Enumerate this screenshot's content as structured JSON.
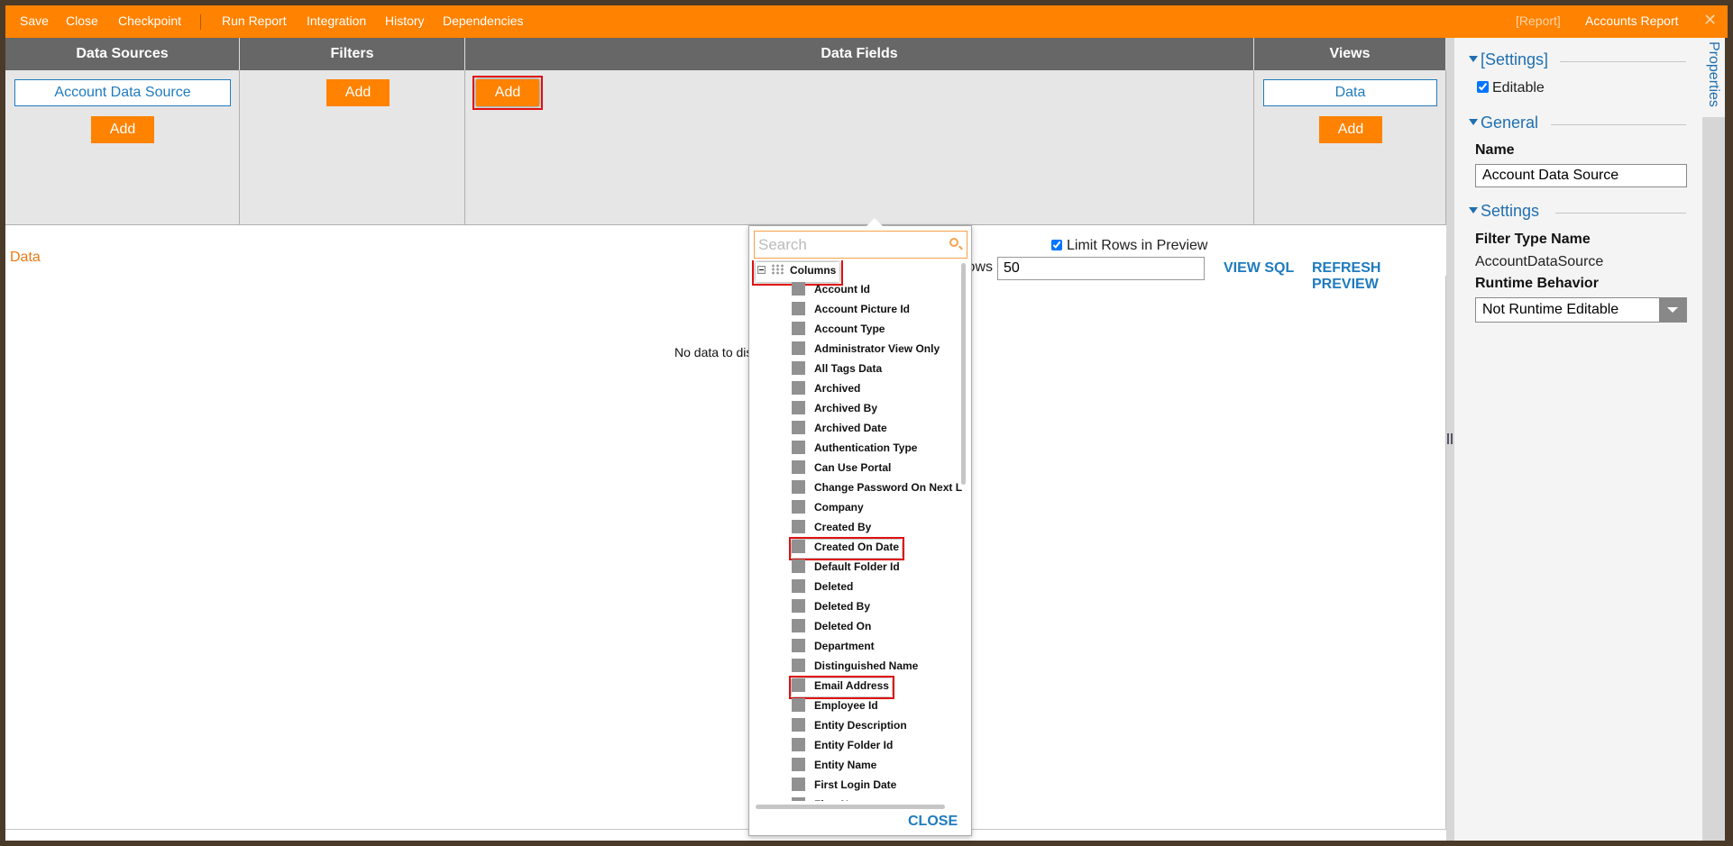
{
  "toolbar": {
    "items": [
      "Save",
      "Close",
      "Checkpoint",
      "Run Report",
      "Integration",
      "History",
      "Dependencies"
    ],
    "context_tag": "[Report]",
    "document_title": "Accounts Report",
    "close_icon": "close-icon"
  },
  "columns": {
    "data_sources": {
      "header": "Data Sources",
      "items": [
        "Account Data Source"
      ],
      "add_label": "Add"
    },
    "filters": {
      "header": "Filters",
      "add_label": "Add"
    },
    "data_fields": {
      "header": "Data Fields",
      "add_label": "Add"
    },
    "views": {
      "header": "Views",
      "items": [
        "Data"
      ],
      "add_label": "Add"
    }
  },
  "preview": {
    "tab_label": "Data",
    "empty_message": "No data to display",
    "limit_rows_label": "Limit Rows in Preview",
    "limit_rows_checked": true,
    "rows_label": "Rows in Preview",
    "rows_value": "50",
    "view_sql_label": "VIEW SQL",
    "refresh_label": "REFRESH PREVIEW"
  },
  "field_picker": {
    "search_placeholder": "Search",
    "search_value": "",
    "group_label": "Columns",
    "items": [
      "Account Id",
      "Account Picture Id",
      "Account Type",
      "Administrator View Only",
      "All Tags Data",
      "Archived",
      "Archived By",
      "Archived Date",
      "Authentication Type",
      "Can Use Portal",
      "Change Password On Next Login",
      "Company",
      "Created By",
      "Created On Date",
      "Default Folder Id",
      "Deleted",
      "Deleted By",
      "Deleted On",
      "Department",
      "Distinguished Name",
      "Email Address",
      "Employee Id",
      "Entity Description",
      "Entity Folder Id",
      "Entity Name",
      "First Login Date",
      "First Name"
    ],
    "highlighted_items": [
      "Created On Date",
      "Email Address"
    ],
    "close_label": "CLOSE"
  },
  "properties": {
    "tab_label": "Properties",
    "sections": {
      "settings_bracket": {
        "title": "[Settings]",
        "editable_label": "Editable",
        "editable_checked": true
      },
      "general": {
        "title": "General",
        "name_label": "Name",
        "name_value": "Account Data Source"
      },
      "settings": {
        "title": "Settings",
        "filter_type_label": "Filter Type Name",
        "filter_type_value": "AccountDataSource",
        "runtime_label": "Runtime Behavior",
        "runtime_value": "Not Runtime Editable"
      }
    }
  },
  "colors": {
    "brand_orange": "#ff8200",
    "header_gray": "#676767",
    "link_blue": "#1f7bbf",
    "highlight_red": "#e01010"
  }
}
